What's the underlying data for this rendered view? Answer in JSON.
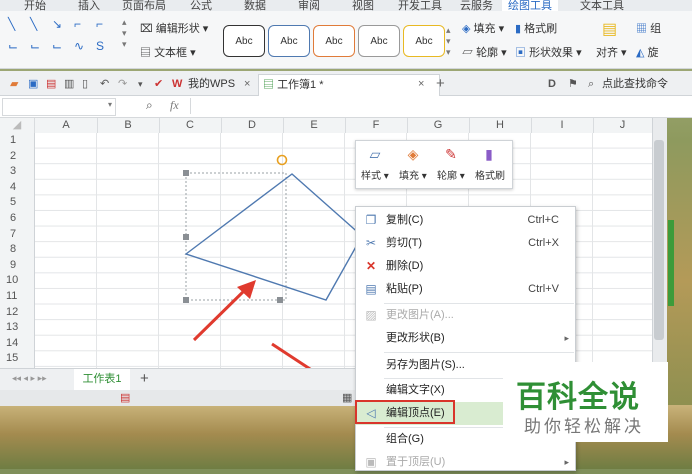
{
  "ribbon_tabs": [
    "开始",
    "插入",
    "页面布局",
    "公式",
    "数据",
    "审阅",
    "视图",
    "开发工具",
    "云服务",
    "绘图工具",
    "文本工具"
  ],
  "active_tab": "绘图工具",
  "ribbon": {
    "edit_shape": "编辑形状",
    "text_box": "文本框",
    "style_samples": [
      "Abc",
      "Abc",
      "Abc",
      "Abc",
      "Abc"
    ],
    "fill": "填充",
    "format_brush": "格式刷",
    "outline": "轮廓",
    "shape_effects": "形状效果",
    "align": "对齐",
    "rotate": "旋",
    "group": "组"
  },
  "docbar": {
    "wps_tab": "我的WPS",
    "workbook_tab": "工作簿1 *",
    "search_text": "点此查找命令"
  },
  "formula_bar": {
    "fx": "fx"
  },
  "columns": [
    "A",
    "B",
    "C",
    "D",
    "E",
    "F",
    "G",
    "H",
    "I",
    "J"
  ],
  "rows": [
    "1",
    "2",
    "3",
    "4",
    "5",
    "6",
    "7",
    "8",
    "9",
    "10",
    "11",
    "12",
    "13",
    "14",
    "15"
  ],
  "sheet_tab": "工作表1",
  "mini_toolbar": {
    "items": [
      "样式",
      "填充",
      "轮廓",
      "格式刷"
    ]
  },
  "context_menu": {
    "copy": {
      "label": "复制(C)",
      "shortcut": "Ctrl+C"
    },
    "cut": {
      "label": "剪切(T)",
      "shortcut": "Ctrl+X"
    },
    "delete": {
      "label": "删除(D)"
    },
    "paste": {
      "label": "粘贴(P)",
      "shortcut": "Ctrl+V"
    },
    "change_picture": {
      "label": "更改图片(A)..."
    },
    "change_shape": {
      "label": "更改形状(B)"
    },
    "save_as_picture": {
      "label": "另存为图片(S)..."
    },
    "edit_text": {
      "label": "编辑文字(X)"
    },
    "edit_points": {
      "label": "编辑顶点(E)"
    },
    "group": {
      "label": "组合(G)"
    },
    "bring_to_front": {
      "label": "置于顶层(U)"
    }
  },
  "watermark": {
    "title": "百科全说",
    "subtitle": "助你轻松解决"
  },
  "colors": {
    "accent_green": "#2f8f35",
    "highlight_red": "#d9352b",
    "shape_stroke": "#4f79b0"
  }
}
